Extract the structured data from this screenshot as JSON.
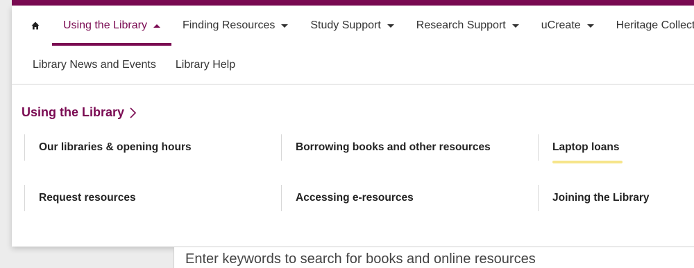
{
  "nav": {
    "home_icon": "home-icon",
    "primary": [
      {
        "label": "Using the Library",
        "active": true
      },
      {
        "label": "Finding Resources",
        "active": false
      },
      {
        "label": "Study Support",
        "active": false
      },
      {
        "label": "Research Support",
        "active": false
      },
      {
        "label": "uCreate",
        "active": false
      },
      {
        "label": "Heritage Collections",
        "active": false
      }
    ],
    "secondary": [
      "Library News and Events",
      "Library Help"
    ]
  },
  "dropdown": {
    "title": "Using the Library",
    "links": [
      "Our libraries & opening hours",
      "Borrowing books and other resources",
      "Laptop loans",
      "Request resources",
      "Accessing e-resources",
      "Joining the Library"
    ]
  },
  "search": {
    "placeholder": "Enter keywords to search for books and online resources"
  },
  "colors": {
    "brand": "#7a0a52",
    "highlight": "#f6e58a"
  }
}
